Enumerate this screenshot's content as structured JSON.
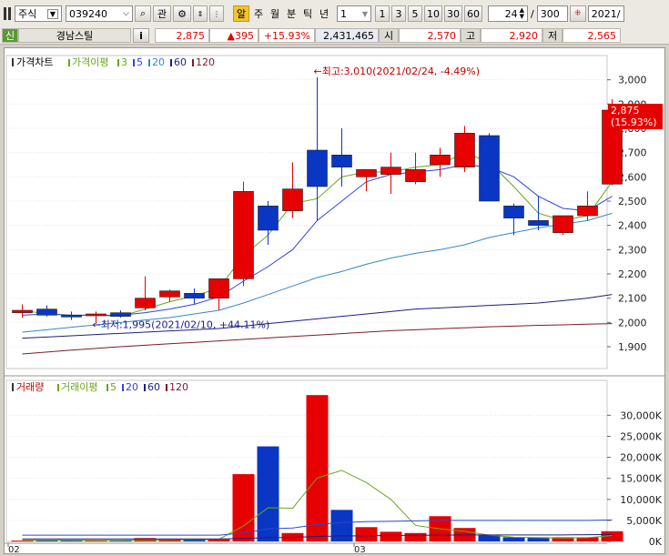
{
  "toolbar": {
    "market_select": "주식",
    "code_input": "039240",
    "btn_interest": "관",
    "btn_new": "알",
    "period_tabs": [
      "주",
      "월",
      "분",
      "틱",
      "년"
    ],
    "interval_value": "1",
    "quick_intervals": [
      "1",
      "3",
      "5",
      "10",
      "30",
      "60"
    ],
    "count_value": "24",
    "separator": "/",
    "total_value": "300",
    "date_value": "2021/"
  },
  "quote": {
    "market_badge": "신",
    "name": "경남스틸",
    "info_btn": "i",
    "price": "2,875",
    "change": "▲395",
    "change_pct": "+15.93%",
    "volume": "2,431,465",
    "open_label": "시",
    "open": "2,570",
    "high_label": "고",
    "high": "2,920",
    "low_label": "저",
    "low": "2,565"
  },
  "colors": {
    "up": "#e60000",
    "down": "#0a36c4",
    "ma3": "#6aa51e",
    "ma5": "#2d46d8",
    "ma20": "#3289c9",
    "ma60": "#1c1f7a",
    "ma120": "#7a1c2a"
  },
  "chart_data": [
    {
      "type": "candlestick",
      "title": "가격차트",
      "legend": [
        {
          "label": "가격이평",
          "color": "#6aa51e"
        },
        {
          "label": "3",
          "color": "#6aa51e"
        },
        {
          "label": "5",
          "color": "#2d46d8"
        },
        {
          "label": "20",
          "color": "#3289c9"
        },
        {
          "label": "60",
          "color": "#1c1f7a"
        },
        {
          "label": "120",
          "color": "#7a1c2a"
        }
      ],
      "x_labels": [
        {
          "index": 0,
          "label": "02"
        },
        {
          "index": 14,
          "label": "03"
        }
      ],
      "ylim": [
        1810,
        3100
      ],
      "yticks": [
        1900,
        2000,
        2100,
        2200,
        2300,
        2400,
        2500,
        2600,
        2700,
        2800,
        2900,
        3000
      ],
      "ytick_labels": [
        "1,900",
        "2,000",
        "2,100",
        "2,200",
        "2,300",
        "2,400",
        "2,500",
        "2,600",
        "2,700",
        "2,800",
        "2,900",
        "3,000"
      ],
      "current_price_label": "2,875",
      "current_pct_label": "(15.93%)",
      "current_price": 2875,
      "candles": [
        {
          "o": 2040,
          "h": 2075,
          "l": 2020,
          "c": 2050
        },
        {
          "o": 2055,
          "h": 2070,
          "l": 2025,
          "c": 2030
        },
        {
          "o": 2030,
          "h": 2045,
          "l": 2010,
          "c": 2025
        },
        {
          "o": 2030,
          "h": 2045,
          "l": 1995,
          "c": 2035
        },
        {
          "o": 2040,
          "h": 2050,
          "l": 2020,
          "c": 2025
        },
        {
          "o": 2060,
          "h": 2190,
          "l": 2050,
          "c": 2100
        },
        {
          "o": 2105,
          "h": 2135,
          "l": 2085,
          "c": 2130
        },
        {
          "o": 2120,
          "h": 2140,
          "l": 2075,
          "c": 2100
        },
        {
          "o": 2100,
          "h": 2175,
          "l": 2050,
          "c": 2180
        },
        {
          "o": 2180,
          "h": 2580,
          "l": 2150,
          "c": 2540
        },
        {
          "o": 2480,
          "h": 2500,
          "l": 2320,
          "c": 2380
        },
        {
          "o": 2460,
          "h": 2660,
          "l": 2430,
          "c": 2550
        },
        {
          "o": 2710,
          "h": 3010,
          "l": 2420,
          "c": 2560
        },
        {
          "o": 2690,
          "h": 2800,
          "l": 2560,
          "c": 2640
        },
        {
          "o": 2600,
          "h": 2620,
          "l": 2540,
          "c": 2630
        },
        {
          "o": 2610,
          "h": 2700,
          "l": 2530,
          "c": 2640
        },
        {
          "o": 2580,
          "h": 2700,
          "l": 2570,
          "c": 2630
        },
        {
          "o": 2650,
          "h": 2720,
          "l": 2600,
          "c": 2690
        },
        {
          "o": 2640,
          "h": 2810,
          "l": 2620,
          "c": 2780
        },
        {
          "o": 2770,
          "h": 2780,
          "l": 2510,
          "c": 2500
        },
        {
          "o": 2480,
          "h": 2490,
          "l": 2360,
          "c": 2430
        },
        {
          "o": 2420,
          "h": 2520,
          "l": 2380,
          "c": 2400
        },
        {
          "o": 2370,
          "h": 2410,
          "l": 2360,
          "c": 2440
        },
        {
          "o": 2440,
          "h": 2540,
          "l": 2420,
          "c": 2480
        },
        {
          "o": 2570,
          "h": 2920,
          "l": 2565,
          "c": 2875
        }
      ],
      "ma": [
        {
          "name": "3",
          "color": "#6aa51e",
          "values": [
            2050,
            2035,
            2030,
            2030,
            2025,
            2055,
            2085,
            2110,
            2140,
            2275,
            2360,
            2490,
            2510,
            2600,
            2620,
            2620,
            2640,
            2650,
            2700,
            2660,
            2560,
            2450,
            2420,
            2440,
            2580
          ]
        },
        {
          "name": "5",
          "color": "#2d46d8",
          "values": [
            2030,
            2035,
            2030,
            2030,
            2030,
            2040,
            2055,
            2075,
            2105,
            2170,
            2230,
            2300,
            2420,
            2500,
            2580,
            2610,
            2620,
            2630,
            2650,
            2640,
            2600,
            2520,
            2470,
            2460,
            2520
          ]
        },
        {
          "name": "20",
          "color": "#3289c9",
          "values": [
            1960,
            1970,
            1980,
            1990,
            2000,
            2010,
            2020,
            2035,
            2050,
            2080,
            2115,
            2150,
            2185,
            2210,
            2240,
            2265,
            2285,
            2300,
            2320,
            2350,
            2370,
            2390,
            2405,
            2420,
            2450
          ]
        },
        {
          "name": "60",
          "color": "#1c1f7a",
          "values": [
            1935,
            1940,
            1945,
            1950,
            1955,
            1960,
            1965,
            1970,
            1975,
            1985,
            1995,
            2005,
            2015,
            2025,
            2035,
            2045,
            2055,
            2060,
            2065,
            2070,
            2075,
            2080,
            2090,
            2100,
            2115
          ]
        },
        {
          "name": "120",
          "color": "#7a1c2a",
          "values": [
            1870,
            1878,
            1886,
            1893,
            1900,
            1906,
            1912,
            1918,
            1924,
            1930,
            1936,
            1942,
            1948,
            1954,
            1960,
            1966,
            1970,
            1974,
            1978,
            1982,
            1985,
            1988,
            1990,
            1993,
            1995
          ]
        }
      ],
      "annotations": [
        {
          "text": "←최고:3,010(2021/02/24, -4.49%)",
          "index": 12,
          "value": 3010
        },
        {
          "text": "←최저:1,995(2021/02/10, +44.11%)",
          "index": 3,
          "value": 1995
        }
      ]
    },
    {
      "type": "bar",
      "title": "거래량",
      "legend": [
        {
          "label": "거래이평",
          "color": "#6aa51e"
        },
        {
          "label": "5",
          "color": "#6aa51e"
        },
        {
          "label": "20",
          "color": "#2d46d8"
        },
        {
          "label": "60",
          "color": "#1c1f7a"
        },
        {
          "label": "120",
          "color": "#7a1c2a"
        }
      ],
      "unit": "K",
      "ylim": [
        0,
        37000
      ],
      "yticks": [
        0,
        5000,
        10000,
        15000,
        20000,
        25000,
        30000
      ],
      "ytick_labels": [
        "0K",
        "5,000K",
        "10,000K",
        "15,000K",
        "20,000K",
        "25,000K",
        "30,000K"
      ],
      "values": [
        200,
        300,
        250,
        200,
        200,
        800,
        500,
        400,
        500,
        16000,
        22600,
        2000,
        34800,
        7500,
        3400,
        2300,
        2000,
        6000,
        3200,
        1500,
        1000,
        1000,
        1000,
        1000,
        2431
      ],
      "colors": [
        "up",
        "down",
        "down",
        "up",
        "down",
        "up",
        "up",
        "down",
        "up",
        "up",
        "down",
        "up",
        "up",
        "down",
        "up",
        "up",
        "up",
        "up",
        "up",
        "down",
        "down",
        "down",
        "up",
        "up",
        "up"
      ],
      "ma5": [
        300,
        300,
        300,
        280,
        260,
        320,
        380,
        430,
        500,
        3700,
        8000,
        7900,
        15100,
        16900,
        14000,
        10000,
        3800,
        3000,
        2400,
        1500,
        1000,
        900,
        800,
        900,
        1400
      ],
      "ma20": [
        1500,
        1500,
        1500,
        1500,
        1500,
        1500,
        1500,
        1500,
        1500,
        2000,
        3000,
        3200,
        4000,
        4500,
        4700,
        4800,
        4900,
        5000,
        5000,
        5000,
        5000,
        5000,
        5000,
        5000,
        5100
      ],
      "ma60": [
        600,
        600,
        600,
        600,
        600,
        600,
        600,
        600,
        600,
        700,
        900,
        950,
        1200,
        1300,
        1350,
        1400,
        1450,
        1500,
        1550,
        1550,
        1550,
        1550,
        1550,
        1600,
        1650
      ]
    }
  ]
}
